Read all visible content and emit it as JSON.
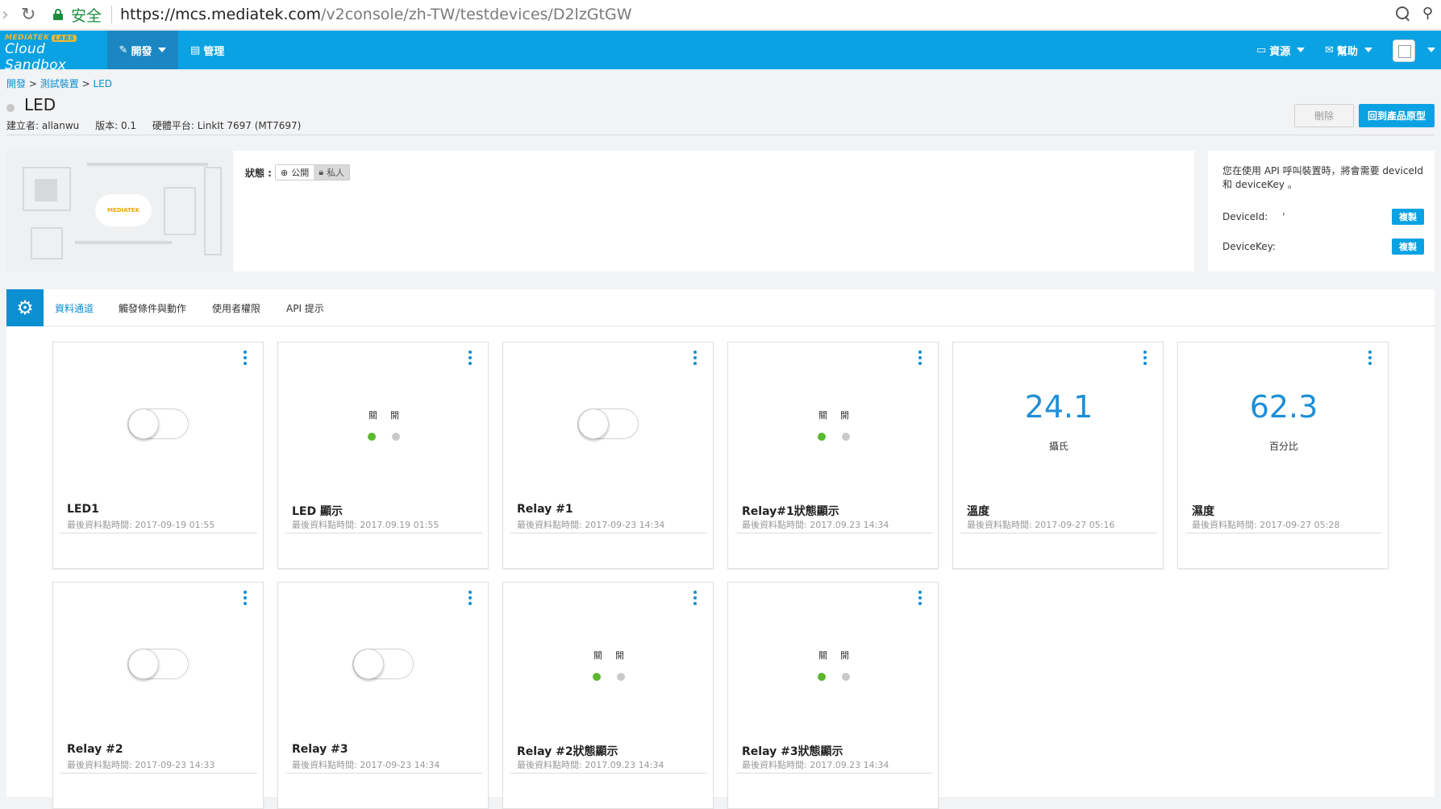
{
  "browser": {
    "secure_label": "安全",
    "url_host": "https://mcs.mediatek.com",
    "url_path": "/v2console/zh-TW/testdevices/D2lzGtGW"
  },
  "header": {
    "logo_brand": "MEDIATEK",
    "logo_labs": "LABS",
    "logo_name": "Cloud Sandbox",
    "nav": {
      "develop": "開發",
      "manage": "管理"
    },
    "resources": "資源",
    "help": "幫助"
  },
  "breadcrumb": {
    "item1": "開發",
    "item2": "測試裝置",
    "item3": "LED",
    "sep": ">"
  },
  "device": {
    "title": "LED",
    "creator": "建立者: allanwu",
    "version": "版本: 0.1",
    "platform": "硬體平台: LinkIt 7697 (MT7697)"
  },
  "actions": {
    "delete": "刪除",
    "back": "回到產品原型"
  },
  "info": {
    "status_label": "狀態 :",
    "public": "公開",
    "private": "私人",
    "hero_logo": "MEDIATEK"
  },
  "api": {
    "description": "您在使用 API 呼叫裝置時，將會需要 deviceId 和 deviceKey 。",
    "device_id_label": "DeviceId:",
    "device_id_value": "'",
    "device_key_label": "DeviceKey:",
    "copy": "複製"
  },
  "tabs": [
    "資料通道",
    "觸發條件與動作",
    "使用者權限",
    "API 提示"
  ],
  "cards": [
    {
      "name": "LED1",
      "time": "最後資料點時間: 2017-09-19 01:55"
    },
    {
      "name": "LED 顯示",
      "time": "最後資料點時間: 2017.09.19 01:55",
      "off": "關",
      "on": "開"
    },
    {
      "name": "Relay #1",
      "time": "最後資料點時間: 2017-09-23 14:34"
    },
    {
      "name": "Relay#1狀態顯示",
      "time": "最後資料點時間: 2017.09.23 14:34",
      "off": "關",
      "on": "開"
    },
    {
      "name": "溫度",
      "time": "最後資料點時間: 2017-09-27 05:16",
      "value": "24.1",
      "unit": "攝氏"
    },
    {
      "name": "濕度",
      "time": "最後資料點時間: 2017-09-27 05:28",
      "value": "62.3",
      "unit": "百分比"
    },
    {
      "name": "Relay #2",
      "time": "最後資料點時間: 2017-09-23 14:33"
    },
    {
      "name": "Relay #3",
      "time": "最後資料點時間: 2017-09-23 14:34"
    },
    {
      "name": "Relay #2狀態顯示",
      "time": "最後資料點時間: 2017.09.23 14:34",
      "off": "關",
      "on": "開"
    },
    {
      "name": "Relay #3狀態顯示",
      "time": "最後資料點時間: 2017.09.23 14:34",
      "off": "關",
      "on": "開"
    }
  ],
  "colors": {
    "accent": "#0aa2e2",
    "dot_green": "#5cb82e",
    "dot_grey": "#c9c9c9"
  }
}
